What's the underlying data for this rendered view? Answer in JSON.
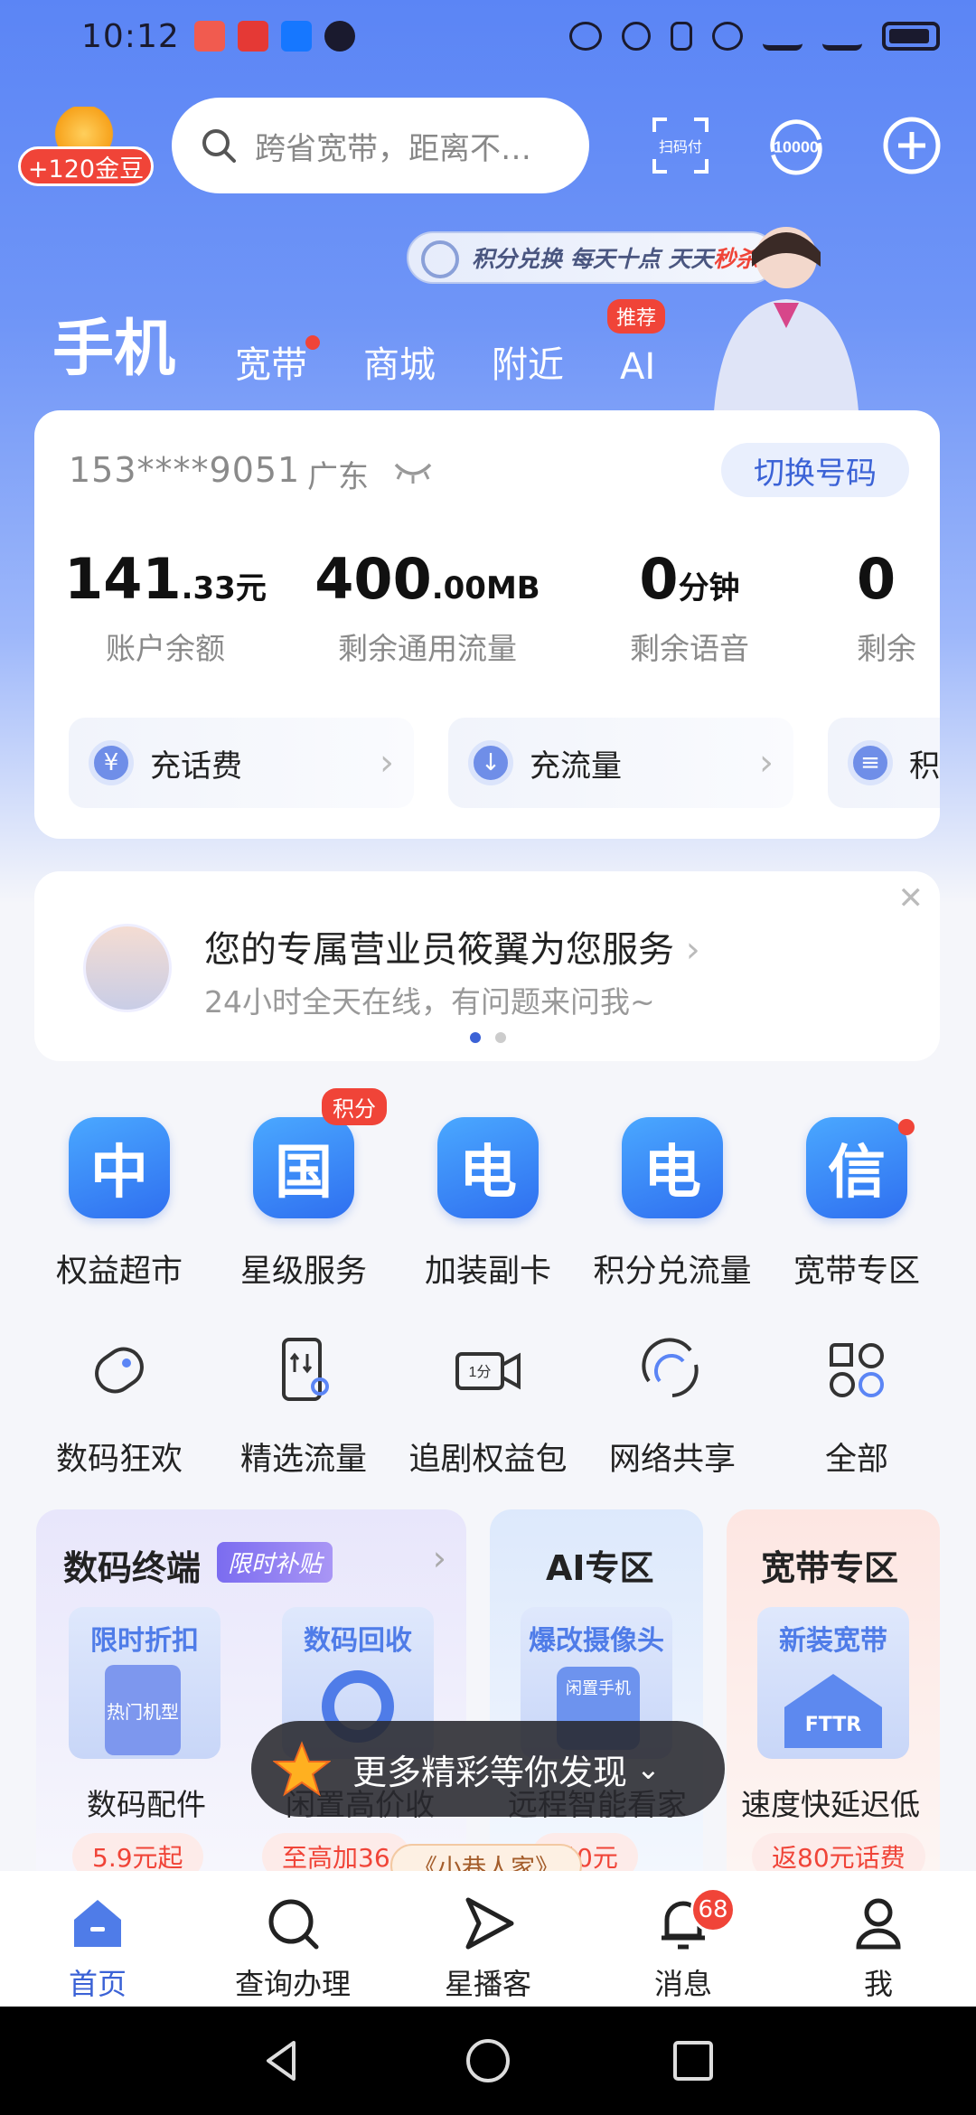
{
  "status_bar": {
    "time": "10:12"
  },
  "header": {
    "coin_badge": "+120金豆",
    "search_placeholder": "跨省宽带，距离不…",
    "scan_pay_label": "扫码付",
    "service_label": "10000"
  },
  "promo_pill": {
    "text_main": "积分兑换 每天十点 天天",
    "text_highlight": "秒杀"
  },
  "tabs": [
    {
      "label": "手机"
    },
    {
      "label": "宽带"
    },
    {
      "label": "商城"
    },
    {
      "label": "附近"
    },
    {
      "label": "AI",
      "tag": "推荐"
    }
  ],
  "account": {
    "phone": "153****9051",
    "region": "广东",
    "switch_label": "切换号码",
    "stats": [
      {
        "value": "141",
        "unit": ".33元",
        "label": "账户余额"
      },
      {
        "value": "400",
        "unit": ".00MB",
        "label": "剩余通用流量"
      },
      {
        "value": "0",
        "unit": "分钟",
        "label": "剩余语音"
      },
      {
        "value": "0",
        "unit": "",
        "label": "剩余"
      }
    ],
    "quick_actions": [
      {
        "label": "充话费",
        "icon": "¥"
      },
      {
        "label": "充流量",
        "icon": "↓"
      },
      {
        "label": "积",
        "icon": "≡"
      }
    ]
  },
  "staff_card": {
    "title": "您的专属营业员筱翼为您服务",
    "subtitle": "24小时全天在线，有问题来问我~"
  },
  "grid_row1": [
    {
      "icon_char": "中",
      "label": "权益超市"
    },
    {
      "icon_char": "国",
      "label": "星级服务",
      "badge": "积分"
    },
    {
      "icon_char": "电",
      "label": "加装副卡"
    },
    {
      "icon_char": "电",
      "label": "积分兑流量"
    },
    {
      "icon_char": "信",
      "label": "宽带专区"
    }
  ],
  "grid_row2": [
    {
      "label": "数码狂欢"
    },
    {
      "label": "精选流量"
    },
    {
      "label": "追剧权益包"
    },
    {
      "label": "网络共享"
    },
    {
      "label": "全部"
    }
  ],
  "promo_cards": {
    "digital": {
      "title": "数码终端",
      "tag": "限时补贴",
      "items": [
        {
          "image_text": "限时折扣",
          "image_sub": "热门机型",
          "label": "数码配件",
          "price": "5.9元起"
        },
        {
          "image_text": "数码回收",
          "label": "闲置高价收",
          "price": "至高加36"
        }
      ]
    },
    "ai": {
      "title": "AI专区",
      "image_text": "爆改摄像头",
      "image_sub": "闲置手机",
      "label": "远程智能看家",
      "price": "月0元"
    },
    "broadband": {
      "title": "宽带专区",
      "image_text": "新装宽带",
      "image_sub": "FTTR",
      "label": "速度快延迟低",
      "price": "返80元话费"
    }
  },
  "toast": {
    "text": "更多精彩等你发现"
  },
  "tip_pill": {
    "text": "《小巷人家》"
  },
  "bottom_nav": [
    {
      "label": "首页"
    },
    {
      "label": "查询办理"
    },
    {
      "label": "星播客"
    },
    {
      "label": "消息",
      "badge": "68"
    },
    {
      "label": "我"
    }
  ],
  "colors": {
    "primary": "#3b62d6",
    "accent_red": "#f04438",
    "hero_blue": "#5b85f5"
  }
}
